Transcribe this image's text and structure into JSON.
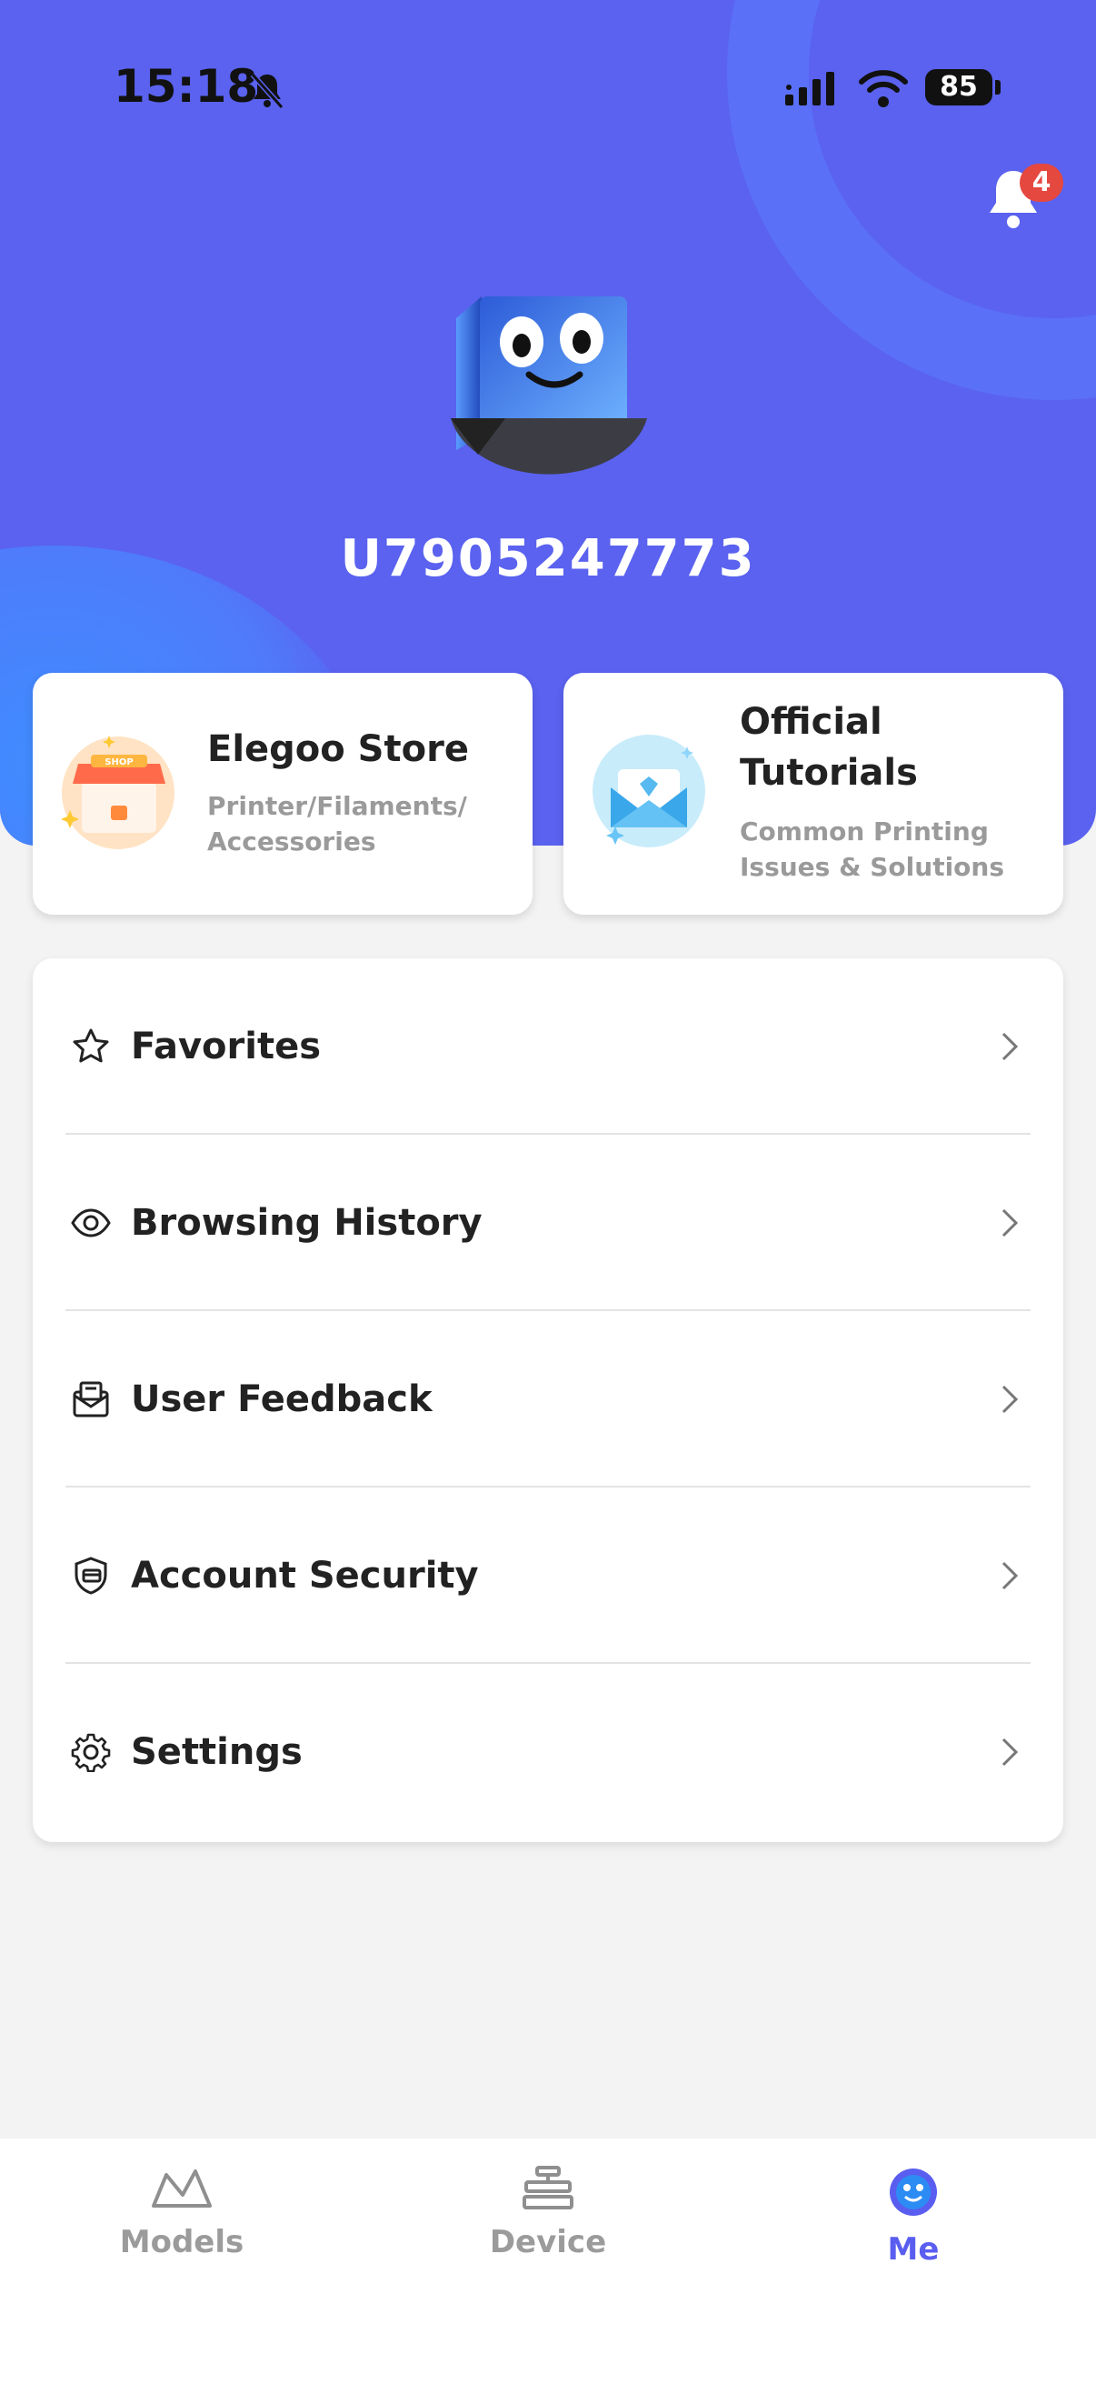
{
  "status_bar": {
    "time": "15:18",
    "battery": "85"
  },
  "notifications": {
    "count": "4"
  },
  "profile": {
    "username": "U7905247773"
  },
  "cards": {
    "store": {
      "title": "Elegoo Store",
      "subtitle": "Printer/Filaments/ Accessories",
      "icon_text": "SHOP"
    },
    "tutorials": {
      "title": "Official Tutorials",
      "subtitle": "Common Printing Issues & Solutions"
    }
  },
  "menu": {
    "items": [
      {
        "label": "Favorites",
        "icon": "star-icon"
      },
      {
        "label": "Browsing History",
        "icon": "eye-icon"
      },
      {
        "label": "User Feedback",
        "icon": "feedback-icon"
      },
      {
        "label": "Account Security",
        "icon": "shield-icon"
      },
      {
        "label": "Settings",
        "icon": "gear-icon"
      }
    ]
  },
  "tabs": [
    {
      "label": "Models",
      "icon": "models-icon",
      "active": false
    },
    {
      "label": "Device",
      "icon": "printer-icon",
      "active": false
    },
    {
      "label": "Me",
      "icon": "me-icon",
      "active": true
    }
  ],
  "colors": {
    "hero": "#5a62ef",
    "accent": "#5a5ef0",
    "badge": "#e5483f"
  }
}
